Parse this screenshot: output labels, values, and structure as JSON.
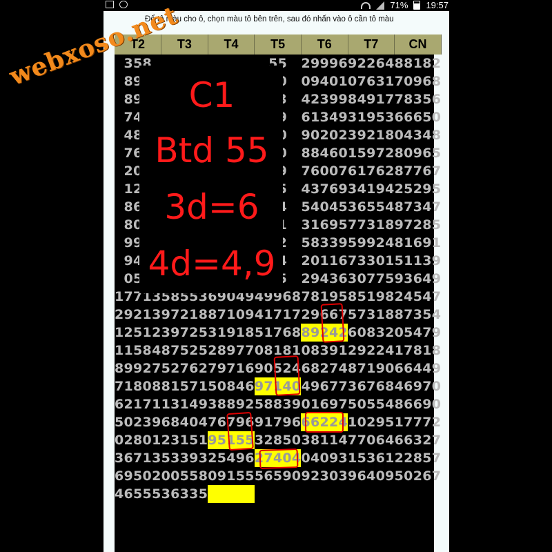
{
  "status_bar": {
    "battery_percent": "71%",
    "time": "19:57",
    "icons": [
      "cast-icon",
      "location-icon",
      "wifi-icon",
      "signal-icon",
      "battery-icon"
    ]
  },
  "instruction": "Để tô màu cho ô, chọn màu tô bên trên, sau đó nhấn vào ô cần tô màu",
  "watermark": "webxoso.net",
  "table": {
    "headers": [
      "T2",
      "T3",
      "T4",
      "T5",
      "T6",
      "T7",
      "CN"
    ],
    "rows": [
      [
        "358",
        "",
        "",
        "55",
        "29996",
        "92264",
        "88182"
      ],
      [
        "896",
        "",
        "",
        "80",
        "09401",
        "07631",
        "70968"
      ],
      [
        "890",
        "",
        "",
        "13",
        "42399",
        "84917",
        "78356"
      ],
      [
        "740",
        "",
        "",
        "29",
        "61349",
        "31953",
        "66650"
      ],
      [
        "485",
        "",
        "",
        "40",
        "90202",
        "39218",
        "04348"
      ],
      [
        "760",
        "",
        "",
        "00",
        "88460",
        "15972",
        "80965"
      ],
      [
        "201",
        "",
        "",
        "89",
        "76007",
        "61762",
        "87767"
      ],
      [
        "129",
        "",
        "",
        "45",
        "43769",
        "34194",
        "25295"
      ],
      [
        "863",
        "",
        "",
        "64",
        "54045",
        "36554",
        "87347"
      ],
      [
        "804",
        "",
        "",
        "91",
        "31695",
        "77318",
        "97285"
      ],
      [
        "993",
        "",
        "",
        "02",
        "58339",
        "59924",
        "81691"
      ],
      [
        "944",
        "",
        "",
        "54",
        "20116",
        "73301",
        "51139"
      ],
      [
        "056",
        "",
        "",
        "55",
        "29436",
        "30775",
        "93649"
      ],
      [
        "17713",
        "58553",
        "69049",
        "49968",
        "78195",
        "85198",
        "24547"
      ],
      [
        "29213",
        "97218",
        "87109",
        "41717",
        "29667",
        "57318",
        "87354"
      ],
      [
        "12512",
        "39725",
        "31918",
        "51768",
        "89242",
        "60832",
        "05479"
      ],
      [
        "11584",
        "87525",
        "28977",
        "08181",
        "08391",
        "29224",
        "17818"
      ],
      [
        "89927",
        "52762",
        "79716",
        "90524",
        "68274",
        "87190",
        "66449"
      ],
      [
        "71808",
        "81571",
        "50846",
        "97140",
        "49677",
        "36768",
        "46970"
      ],
      [
        "62171",
        "13149",
        "38892",
        "58839",
        "01697",
        "50554",
        "86690"
      ],
      [
        "50239",
        "68404",
        "76796",
        "91796",
        "66224",
        "10295",
        "17772"
      ],
      [
        "02801",
        "23151",
        "95155",
        "32850",
        "38114",
        "77064",
        "66327"
      ],
      [
        "36713",
        "53393",
        "25496",
        "27404",
        "04093",
        "15361",
        "22857"
      ],
      [
        "69502",
        "00558",
        "09155",
        "56590",
        "92303",
        "96409",
        "50267"
      ],
      [
        "46555",
        "36335",
        "",
        "",
        "",
        "",
        ""
      ]
    ],
    "highlighted_color": "#ffff00"
  },
  "overlay": {
    "line1": "C1",
    "line2": "Btd 55",
    "line3": "3d=6",
    "line4": "4d=4,9",
    "color": "#ff1a1a"
  }
}
